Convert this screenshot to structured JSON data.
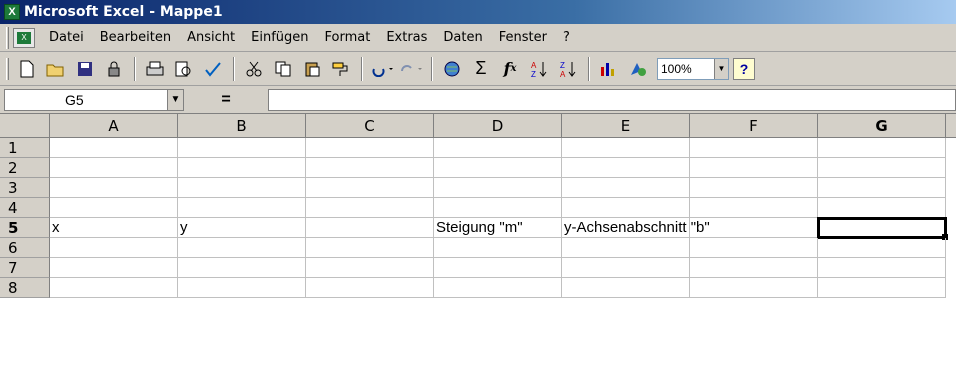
{
  "window": {
    "title": "Microsoft Excel - Mappe1"
  },
  "menu": {
    "items": [
      "Datei",
      "Bearbeiten",
      "Ansicht",
      "Einfügen",
      "Format",
      "Extras",
      "Daten",
      "Fenster",
      "?"
    ]
  },
  "toolbar": {
    "icons": [
      "new-icon",
      "open-icon",
      "save-icon",
      "permission-icon",
      "print-icon",
      "print-preview-icon",
      "spellcheck-icon",
      "cut-icon",
      "copy-icon",
      "paste-icon",
      "format-painter-icon",
      "undo-icon",
      "redo-icon",
      "hyperlink-icon",
      "autosum-icon",
      "function-icon",
      "sort-asc-icon",
      "sort-desc-icon",
      "chart-wizard-icon",
      "drawing-icon"
    ],
    "zoom": "100%"
  },
  "formula_bar": {
    "name_box": "G5",
    "equals": "=",
    "formula": ""
  },
  "sheet": {
    "columns": [
      "A",
      "B",
      "C",
      "D",
      "E",
      "F",
      "G"
    ],
    "active_column": "G",
    "active_row": "5",
    "rows": [
      {
        "num": "1",
        "cells": [
          "",
          "",
          "",
          "",
          "",
          "",
          ""
        ]
      },
      {
        "num": "2",
        "cells": [
          "",
          "",
          "",
          "",
          "",
          "",
          ""
        ]
      },
      {
        "num": "3",
        "cells": [
          "",
          "",
          "",
          "",
          "",
          "",
          ""
        ]
      },
      {
        "num": "4",
        "cells": [
          "",
          "",
          "",
          "",
          "",
          "",
          ""
        ]
      },
      {
        "num": "5",
        "cells": [
          "x",
          "y",
          "",
          "Steigung \"m\"",
          "y-Achsenabschnitt \"b\"",
          "",
          ""
        ]
      },
      {
        "num": "6",
        "cells": [
          "",
          "",
          "",
          "",
          "",
          "",
          ""
        ]
      },
      {
        "num": "7",
        "cells": [
          "",
          "",
          "",
          "",
          "",
          "",
          ""
        ]
      },
      {
        "num": "8",
        "cells": [
          "",
          "",
          "",
          "",
          "",
          "",
          ""
        ]
      }
    ]
  }
}
